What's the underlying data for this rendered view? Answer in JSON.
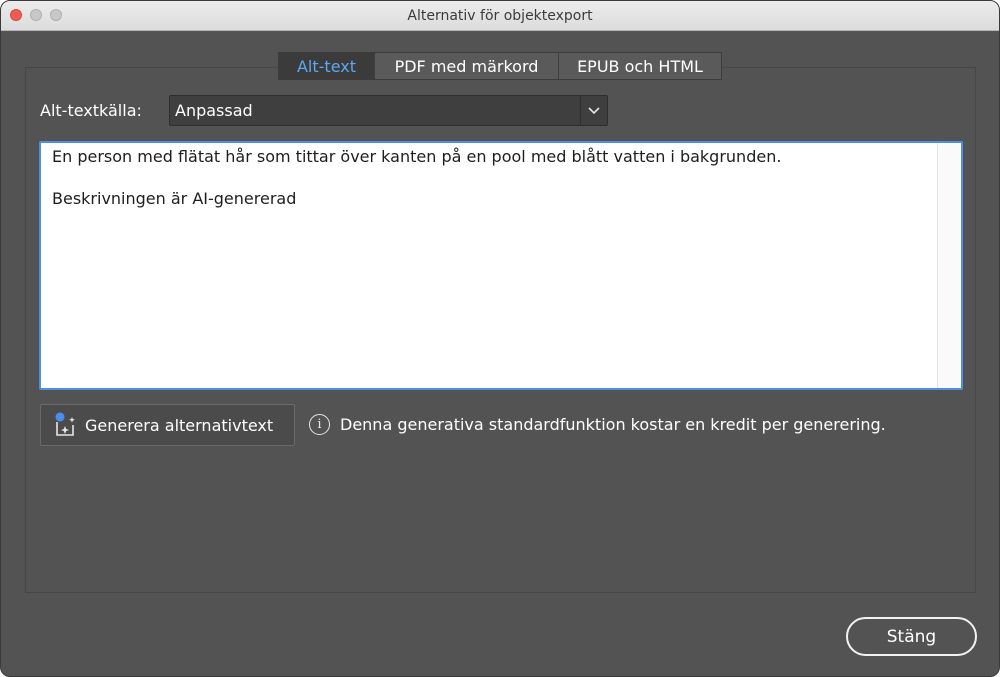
{
  "window": {
    "title": "Alternativ för objektexport"
  },
  "tabs": [
    {
      "label": "Alt-text",
      "active": true
    },
    {
      "label": "PDF med märkord",
      "active": false
    },
    {
      "label": "EPUB och HTML",
      "active": false
    }
  ],
  "source": {
    "label": "Alt-textkälla:",
    "selected": "Anpassad"
  },
  "alt_text": {
    "line1": "En person med flätat hår som tittar över kanten på en pool med blått vatten i bakgrunden.",
    "line2": "Beskrivningen är AI-genererad"
  },
  "generate": {
    "label": "Generera alternativtext",
    "icon": "sparkle-generate-icon"
  },
  "info": {
    "icon": "info-icon",
    "text": "Denna generativa standardfunktion kostar en kredit per generering."
  },
  "footer": {
    "close_label": "Stäng"
  },
  "colors": {
    "accent": "#5ea8f2",
    "focus_border": "#4d8fe0",
    "window_bg": "#535353"
  }
}
